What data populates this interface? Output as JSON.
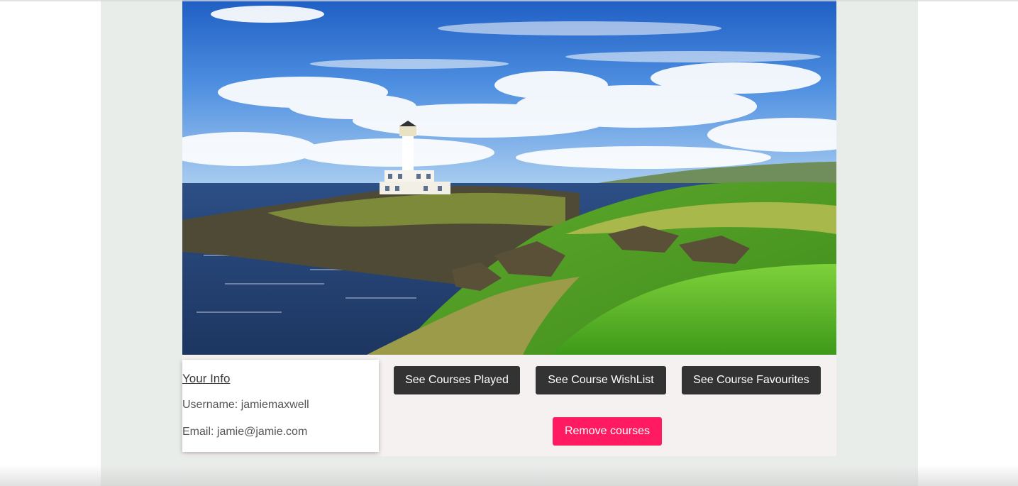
{
  "hero": {
    "image_alt": "Coastal golf course with lighthouse"
  },
  "info": {
    "title": "Your Info",
    "username": "Username: jamiemaxwell",
    "email": "Email: jamie@jamie.com"
  },
  "buttons": {
    "played": "See Courses Played",
    "wishlist": "See Course WishList",
    "favourites": "See Course Favourites",
    "remove": "Remove courses"
  },
  "colors": {
    "dark_button": "#333333",
    "accent_button": "#ff1a61",
    "page_column": "#e9edea",
    "panel": "#f6f1f1"
  }
}
